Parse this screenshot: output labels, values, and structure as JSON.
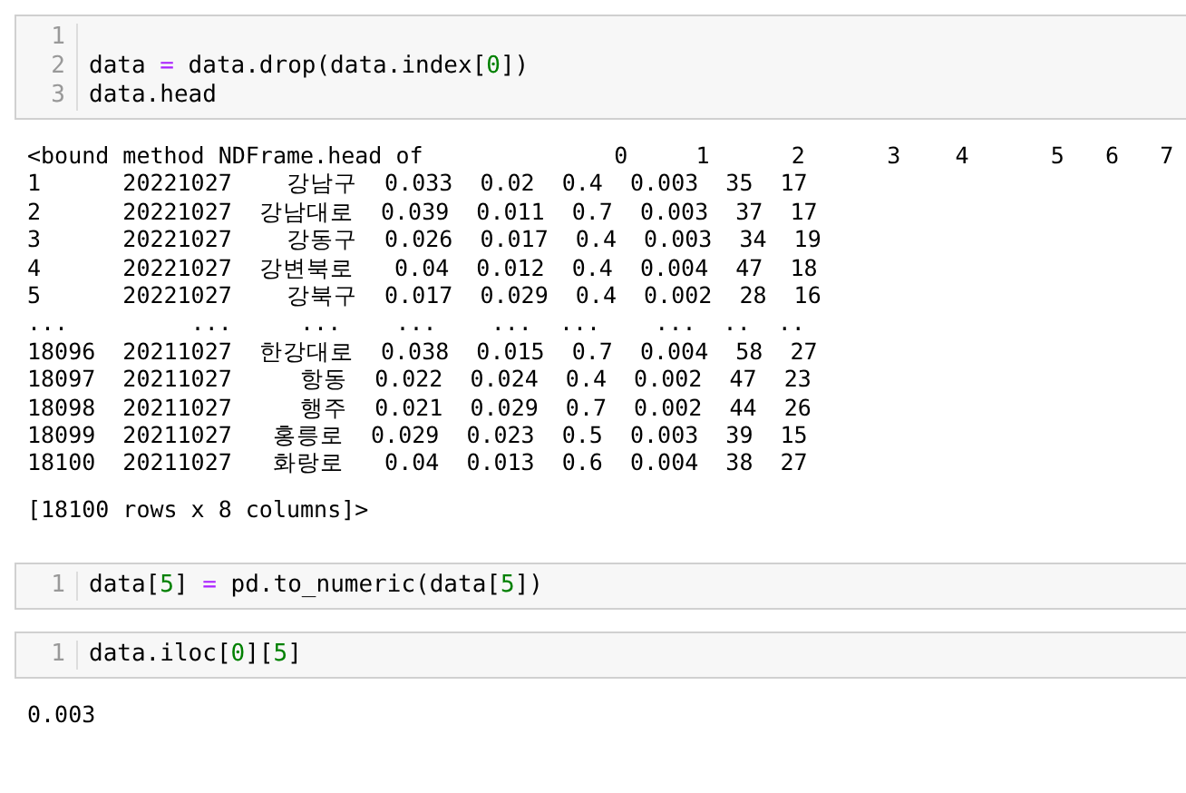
{
  "cells": [
    {
      "kind": "code",
      "lines": [
        {
          "number": "1"
        },
        {
          "number": "2",
          "tokens": [
            {
              "kind": "plain",
              "text": "data "
            },
            {
              "kind": "operator",
              "text": "="
            },
            {
              "kind": "plain",
              "text": " data.drop(data.index["
            },
            {
              "kind": "number",
              "text": "0"
            },
            {
              "kind": "plain",
              "text": "])"
            }
          ]
        },
        {
          "number": "3",
          "tokens": [
            {
              "kind": "plain",
              "text": "data.head"
            }
          ]
        }
      ]
    },
    {
      "kind": "output",
      "blocks": [
        [
          "<bound method NDFrame.head of              0     1      2      3    4      5   6   7",
          "1      20221027    강남구  0.033  0.02  0.4  0.003  35  17",
          "2      20221027  강남대로  0.039  0.011  0.7  0.003  37  17",
          "3      20221027    강동구  0.026  0.017  0.4  0.003  34  19",
          "4      20221027  강변북로   0.04  0.012  0.4  0.004  47  18",
          "5      20221027    강북구  0.017  0.029  0.4  0.002  28  16",
          "...         ...     ...    ...    ...  ...    ...  ..  ..",
          "18096  20211027  한강대로  0.038  0.015  0.7  0.004  58  27",
          "18097  20211027     항동  0.022  0.024  0.4  0.002  47  23",
          "18098  20211027     행주  0.021  0.029  0.7  0.002  44  26",
          "18099  20211027   홍릉로  0.029  0.023  0.5  0.003  39  15",
          "18100  20211027   화랑로   0.04  0.013  0.6  0.004  38  27"
        ],
        [
          "[18100 rows x 8 columns]>"
        ]
      ]
    },
    {
      "kind": "code",
      "lines": [
        {
          "number": "1",
          "tokens": [
            {
              "kind": "plain",
              "text": "data["
            },
            {
              "kind": "number",
              "text": "5"
            },
            {
              "kind": "plain",
              "text": "] "
            },
            {
              "kind": "operator",
              "text": "="
            },
            {
              "kind": "plain",
              "text": " pd.to_numeric(data["
            },
            {
              "kind": "number",
              "text": "5"
            },
            {
              "kind": "plain",
              "text": "])"
            }
          ]
        }
      ]
    },
    {
      "kind": "code",
      "lines": [
        {
          "number": "1",
          "tokens": [
            {
              "kind": "plain",
              "text": "data.iloc["
            },
            {
              "kind": "number",
              "text": "0"
            },
            {
              "kind": "plain",
              "text": "]["
            },
            {
              "kind": "number",
              "text": "5"
            },
            {
              "kind": "plain",
              "text": "]"
            }
          ]
        }
      ]
    },
    {
      "kind": "output",
      "blocks": [
        [
          "0.003"
        ]
      ]
    }
  ]
}
